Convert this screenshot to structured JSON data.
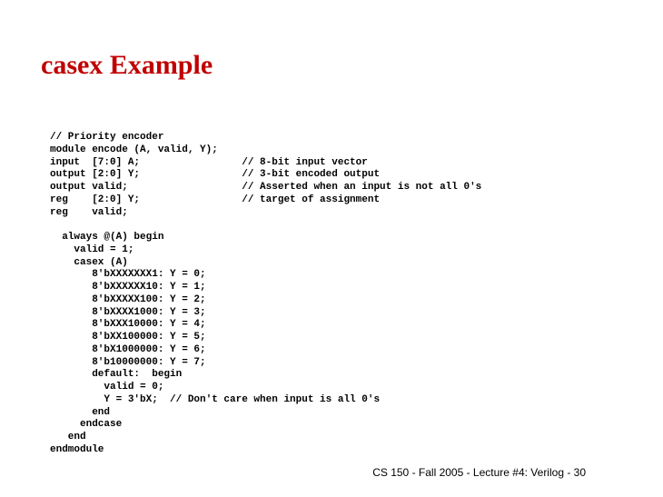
{
  "title": "casex Example",
  "code": "// Priority encoder\nmodule encode (A, valid, Y);\ninput  [7:0] A;                 // 8-bit input vector\noutput [2:0] Y;                 // 3-bit encoded output\noutput valid;                   // Asserted when an input is not all 0's\nreg    [2:0] Y;                 // target of assignment\nreg    valid;\n\n  always @(A) begin\n    valid = 1;\n    casex (A)\n       8'bXXXXXXX1: Y = 0;\n       8'bXXXXXX10: Y = 1;\n       8'bXXXXX100: Y = 2;\n       8'bXXXX1000: Y = 3;\n       8'bXXX10000: Y = 4;\n       8'bXX100000: Y = 5;\n       8'bX1000000: Y = 6;\n       8'b10000000: Y = 7;\n       default:  begin\n         valid = 0;\n         Y = 3'bX;  // Don't care when input is all 0's\n       end\n     endcase\n   end\nendmodule",
  "footer": "CS 150 - Fall 2005 - Lecture #4: Verilog - 30"
}
